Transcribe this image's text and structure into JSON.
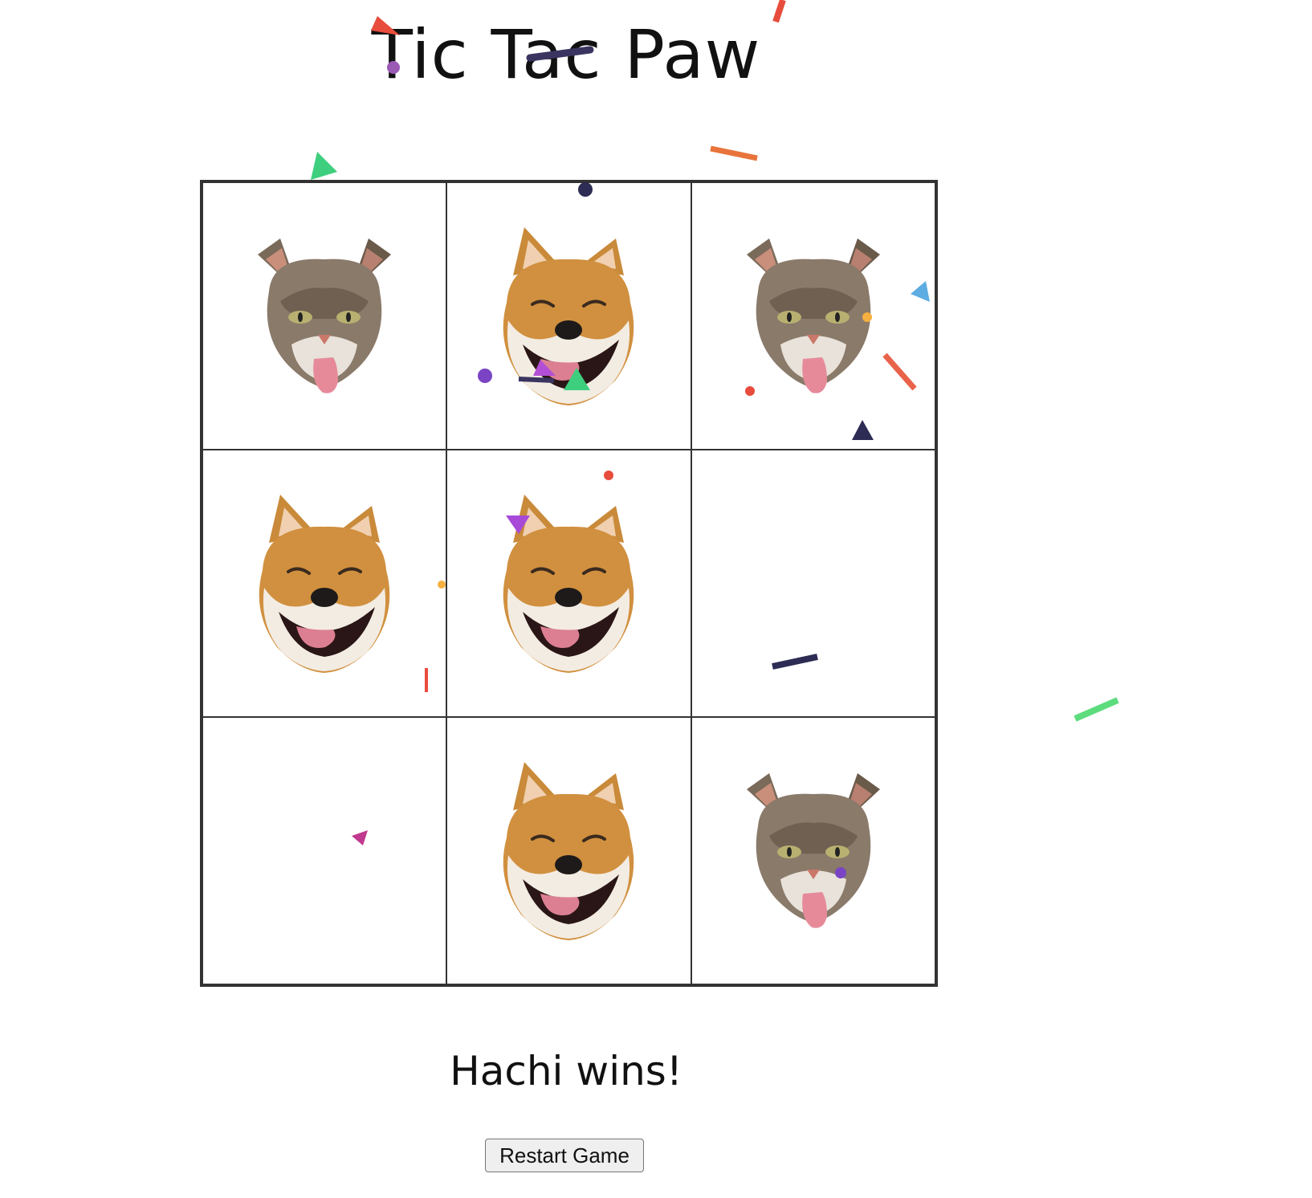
{
  "game": {
    "title": "Tic Tac Paw",
    "status": "Hachi wins!",
    "restart_label": "Restart Game"
  },
  "board": {
    "cells": [
      {
        "piece": "cat"
      },
      {
        "piece": "dog"
      },
      {
        "piece": "cat"
      },
      {
        "piece": "dog"
      },
      {
        "piece": "dog"
      },
      {
        "piece": "empty"
      },
      {
        "piece": "empty"
      },
      {
        "piece": "dog"
      },
      {
        "piece": "cat"
      }
    ]
  },
  "pieces": {
    "cat": {
      "icon": "cat-face-icon"
    },
    "dog": {
      "icon": "shiba-dog-face-icon"
    }
  },
  "colors": {
    "text": "#111111",
    "grid": "#333333",
    "confetti": [
      "#e74c3c",
      "#2ecc71",
      "#9b59b6",
      "#3498db",
      "#f39c12",
      "#2c2c54",
      "#c0398e",
      "#e8743b"
    ]
  }
}
